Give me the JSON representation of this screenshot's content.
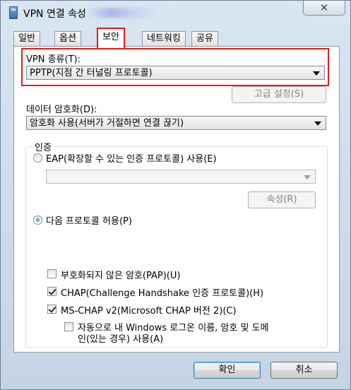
{
  "window": {
    "title": "VPN 연결 속성",
    "close_label": "✕"
  },
  "tabs": [
    {
      "label": "일반"
    },
    {
      "label": "옵션"
    },
    {
      "label": "보안"
    },
    {
      "label": "네트워킹"
    },
    {
      "label": "공유"
    }
  ],
  "security": {
    "vpn_type_label": "VPN 종류(T):",
    "vpn_type_value": "PPTP(지점 간 터널링 프로토콜)",
    "advanced_button": "고급 설정(S)",
    "encryption_label": "데이터 암호화(D):",
    "encryption_value": "암호화 사용(서버가 거절하면 연결 끊기)",
    "auth_group_title": "인증",
    "eap_radio_label": "EAP(확장할 수 있는 인증 프로토콜) 사용(E)",
    "eap_select_value": "",
    "properties_button": "속성(R)",
    "allow_protocols_label": "다음 프로토콜 허용(P)",
    "pap_label": "부호화되지 않은 암호(PAP)(U)",
    "chap_label": "CHAP(Challenge Handshake 인증 프로토콜)(H)",
    "mschap_label": "MS-CHAP v2(Microsoft CHAP 버전 2)(C)",
    "auto_logon_line1": "자동으로 내 Windows 로그온 이름, 암호 및 도메",
    "auto_logon_line2": "인(있는 경우) 사용(A)"
  },
  "footer": {
    "ok_button": "확인",
    "cancel_button": "취소"
  }
}
